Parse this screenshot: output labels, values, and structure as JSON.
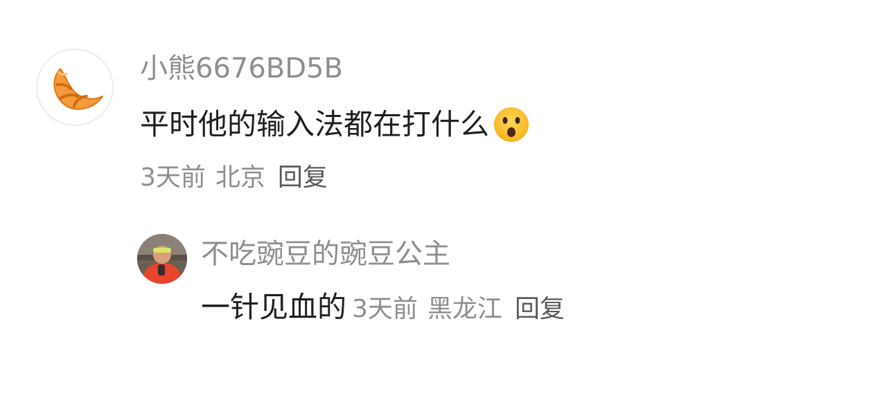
{
  "comment": {
    "username": "小熊6676BD5B",
    "avatar_icon": "croissant-icon",
    "text": "平时他的输入法都在打什么",
    "emoji": "frowning-face-open-mouth-emoji",
    "time": "3天前",
    "location": "北京",
    "reply_label": "回复"
  },
  "reply": {
    "username": "不吃豌豆的豌豆公主",
    "avatar_icon": "photo-avatar",
    "text": "一针见血的",
    "time": "3天前",
    "location": "黑龙江",
    "reply_label": "回复"
  },
  "colors": {
    "text_primary": "#1f1f1f",
    "text_secondary": "#8e8e8e",
    "croissant": "#f28c28"
  }
}
